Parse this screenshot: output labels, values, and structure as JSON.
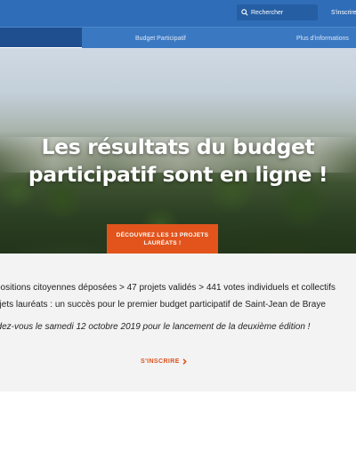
{
  "header": {
    "search_placeholder": "Rechercher",
    "signup_label": "S'inscrire",
    "colors": {
      "topbar": "#2f6db8",
      "nav": "#3a78c2",
      "active_tab": "#1f4f8e"
    }
  },
  "nav": {
    "tabs": [
      {
        "label": "Accueil",
        "visible_text": "ueil",
        "active": true
      },
      {
        "label": "Budget Participatif",
        "active": false
      },
      {
        "label": "Plus d'informations",
        "active": false
      }
    ]
  },
  "hero": {
    "title_line1": "Les résultats du budget",
    "title_line2": "participatif sont en ligne !",
    "cta_line1": "DÉCOUVREZ LES 13 PROJETS",
    "cta_line2": "LAURÉATS !",
    "cta_color": "#e2541c"
  },
  "stats": {
    "line1": "positions citoyennes déposées > 47 projets validés > 441 votes individuels et collectifs",
    "line2": "ojets lauréats : un succès pour le premier budget participatif de Saint-Jean de Braye",
    "line3": "ndez-vous le samedi 12 octobre 2019 pour le lancement de la deuxième édition !",
    "signup_label": "S'INSCRIRE",
    "accent_color": "#d9531e"
  }
}
